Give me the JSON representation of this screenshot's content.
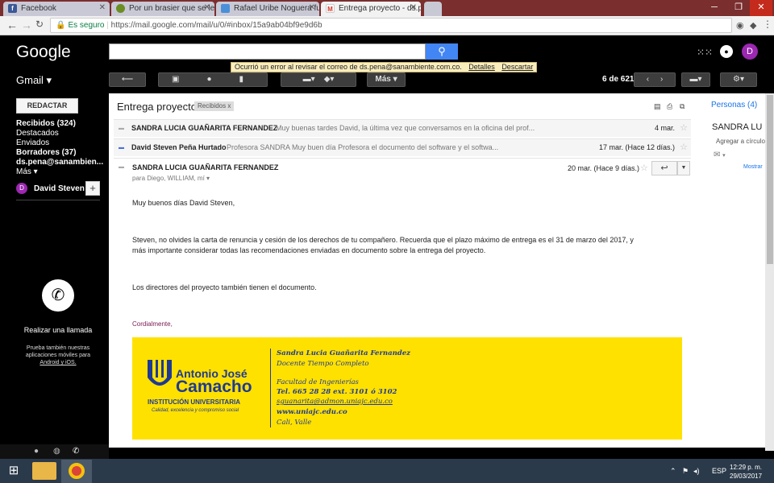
{
  "browser": {
    "tabs": [
      {
        "label": "Facebook",
        "icon": "facebook-icon",
        "color": "#3b5998"
      },
      {
        "label": "Por un brasier que se le j",
        "icon": "web-icon",
        "color": "#6b8e23"
      },
      {
        "label": "Rafael Uribe Noguera fu",
        "icon": "web-icon",
        "color": "#4a90d9"
      },
      {
        "label": "Entrega proyecto - ds.pen",
        "icon": "gmail-icon",
        "color": "#d93025",
        "active": true
      }
    ],
    "secure_label": "Es seguro",
    "url": "https://mail.google.com/mail/u/0/#inbox/15a9ab04bf9e9d6b"
  },
  "gmail": {
    "logo": "Google",
    "app_label": "Gmail ▾",
    "error_message": "Ocurrió un error al revisar el correo de ds.pena@sanambiente.com.co.",
    "error_details": "Detalles",
    "error_dismiss": "Descartar",
    "avatar_letter": "D",
    "toolbar": {
      "more_label": "Más ▾",
      "pager": "6 de 621"
    },
    "compose_label": "REDACTAR",
    "nav": [
      {
        "label": "Recibidos (324)",
        "bold": true
      },
      {
        "label": "Destacados",
        "bold": false
      },
      {
        "label": "Enviados",
        "bold": false
      },
      {
        "label": "Borradores (37)",
        "bold": true
      },
      {
        "label": "ds.pena@sanambien...",
        "bold": true
      },
      {
        "label": "Más ▾",
        "bold": false
      }
    ],
    "user": {
      "letter": "D",
      "name": "David Steven ▾"
    },
    "call": {
      "title": "Realizar una llamada",
      "desc_line1": "Prueba también nuestras",
      "desc_line2": "aplicaciones móviles para",
      "desc_line3": "Android y iOS."
    }
  },
  "thread": {
    "subject": "Entrega proyecto",
    "label_chip": "Recibidos   x",
    "messages": [
      {
        "sender": "SANDRA LUCIA GUAÑARITA FERNANDEZ",
        "snippet": "Muy buenas tardes David, la última vez que conversamos en la oficina del prof...",
        "date": "4 mar."
      },
      {
        "sender": "David Steven Peña Hurtado",
        "snippet": "Profesora SANDRA Muy buen día Profesora el documento del software y el softwa...",
        "date": "17 mar. (Hace 12 días.)"
      }
    ],
    "open": {
      "sender": "SANDRA LUCIA GUAÑARITA FERNANDEZ",
      "to": "para Diego, WILLIAM, mí ▾",
      "date": "20 mar. (Hace 9 días.)",
      "greeting": "Muy buenos días David Steven,",
      "para1_line1": "Steven, no olvides la carta de renuncia y cesión de los derechos de tu compañero.  Recuerda que el plazo máximo de entrega es el 31 de marzo del 2017, y",
      "para1_line2": "más importante considerar todas las recomendaciones enviadas en documento sobre la entrega del proyecto.",
      "para2": "Los directores del proyecto también tienen el documento.",
      "closing": "Cordialmente,"
    },
    "signature": {
      "logo_name1": "Antonio José",
      "logo_name2": "Camacho",
      "logo_institution": "INSTITUCIÓN UNIVERSITARIA",
      "logo_tagline": "Calidad, excelencia y compromiso social",
      "name": "Sandra Lucia Guañarita Fernandez",
      "role": "Docente Tiempo Completo",
      "faculty": "Facultad de Ingenierías",
      "phone": "Tel. 665 28 28 ext. 3101 ó 3102",
      "email": "sguanarita@admon.uniajc.edu.co",
      "web": "www.uniajc.edu.co",
      "city": "Cali, Valle"
    }
  },
  "people_panel": {
    "title": "Personas (4)",
    "name": "SANDRA LU",
    "add_circle": "Agregar a círculo",
    "more": "Mostrar"
  },
  "taskbar": {
    "language": "ESP",
    "time": "12:29 p. m.",
    "date": "29/03/2017"
  }
}
